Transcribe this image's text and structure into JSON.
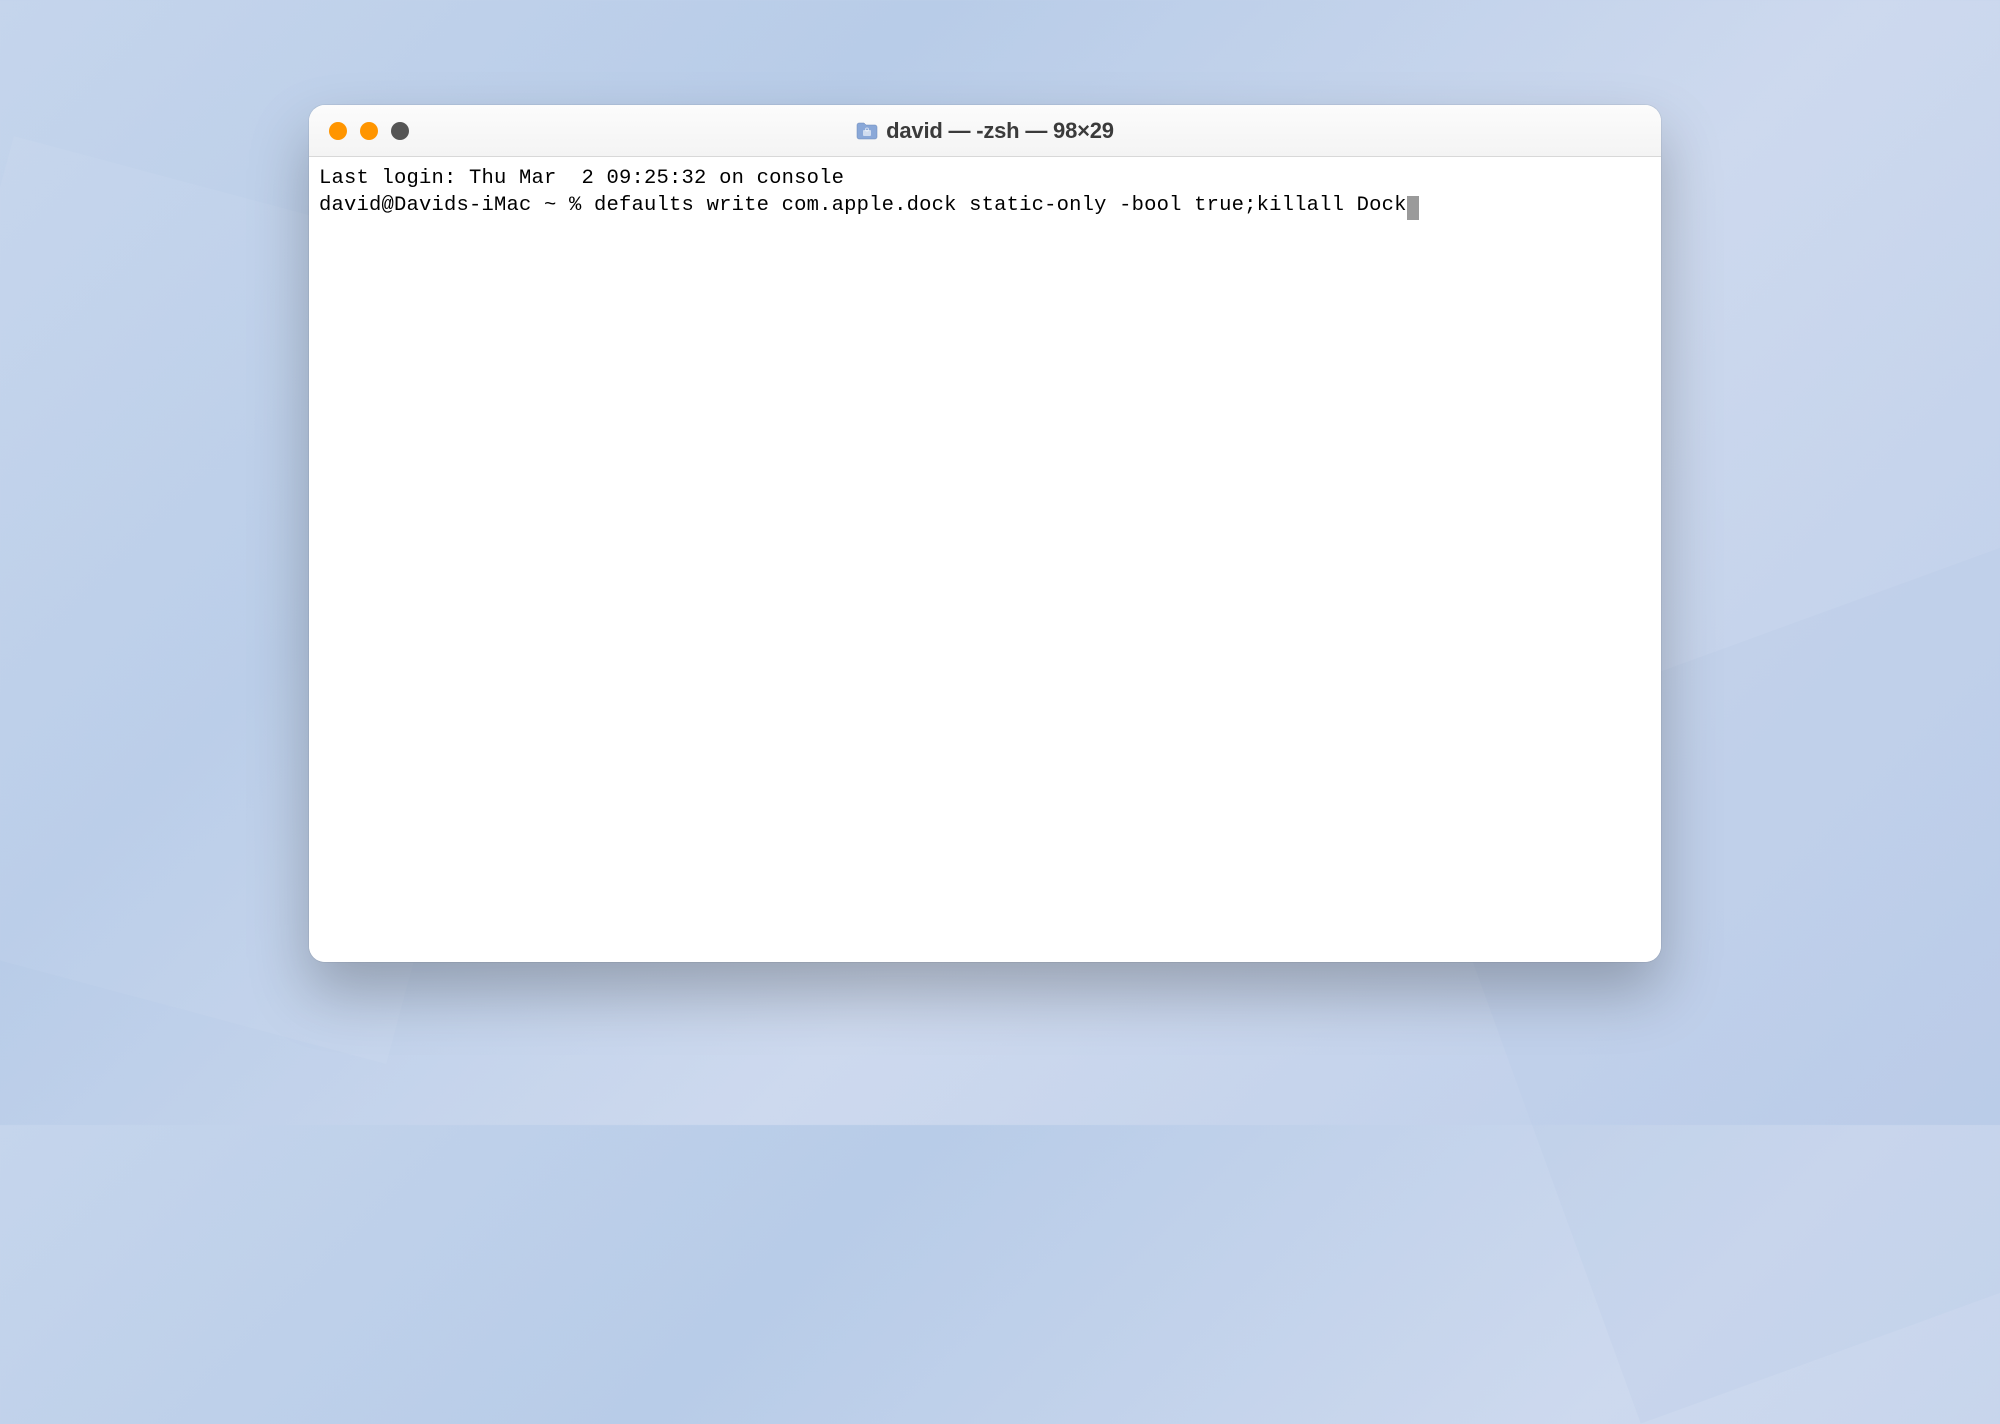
{
  "window": {
    "title": "david — -zsh — 98×29"
  },
  "terminal": {
    "last_login": "Last login: Thu Mar  2 09:25:32 on console",
    "prompt": "david@Davids-iMac ~ % ",
    "command": "defaults write com.apple.dock static-only -bool true;killall Dock"
  }
}
